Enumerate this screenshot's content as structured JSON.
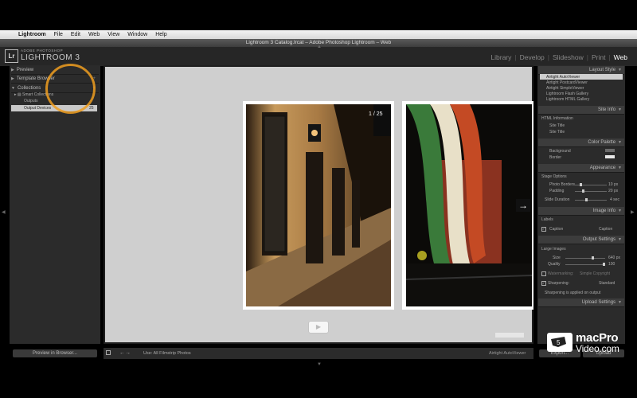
{
  "menubar": {
    "app": "Lightroom",
    "items": [
      "File",
      "Edit",
      "Web",
      "View",
      "Window",
      "Help"
    ]
  },
  "window_title": "Lightroom 3 Catalog.lrcat – Adobe Photoshop Lightroom – Web",
  "header": {
    "logo": "Lr",
    "brand_small": "ADOBE PHOTOSHOP",
    "brand": "LIGHTROOM 3",
    "modules": [
      "Library",
      "Develop",
      "Slideshow",
      "Print",
      "Web"
    ],
    "active_module": "Web"
  },
  "left_panel": {
    "sections": {
      "preview": "Preview",
      "template_browser": "Template Browser",
      "collections": "Collections"
    },
    "collection_items": [
      "Smart Collections",
      "Outputs",
      "Output Devices"
    ],
    "selected_count": "25",
    "preview_button": "Preview in Browser..."
  },
  "canvas": {
    "counter": "1 / 25",
    "next_glyph": "→",
    "play_glyph": "▶"
  },
  "toolbar": {
    "use_label": "Use: All Filmstrip Photos",
    "style_label": "Airtight AutoViewer",
    "prev": "←",
    "next": "→"
  },
  "right_panel": {
    "layout_style": {
      "title": "Layout Style",
      "options": [
        "Airtight AutoViewer",
        "Airtight PostcardViewer",
        "Airtight SimpleViewer",
        "Lightroom Flash Gallery",
        "Lightroom HTML Gallery"
      ],
      "selected": 0
    },
    "site_info": {
      "title": "Site Info",
      "subtitle": "HTML Information",
      "fields": [
        "Site Title",
        "Site Title"
      ]
    },
    "color_palette": {
      "title": "Color Palette",
      "rows": [
        {
          "label": "Background",
          "color": "#6a6a6a"
        },
        {
          "label": "Border",
          "color": "#e8e8e8"
        }
      ]
    },
    "appearance": {
      "title": "Appearance",
      "subtitle": "Stage Options",
      "rows": [
        {
          "label": "Photo Borders",
          "value": "10 px",
          "fraction": 0.15
        },
        {
          "label": "Padding",
          "value": "20 px",
          "fraction": 0.25
        },
        {
          "label": "Slide Duration",
          "value": "4 sec",
          "fraction": 0.35
        }
      ]
    },
    "image_info": {
      "title": "Image Info",
      "subtitle": "Labels",
      "caption_label": "Caption",
      "caption_value": "Caption"
    },
    "output_settings": {
      "title": "Output Settings",
      "subtitle": "Large Images",
      "rows": [
        {
          "label": "Size",
          "value": "640 px",
          "fraction": 0.7
        },
        {
          "label": "Quality",
          "value": "100",
          "fraction": 1.0
        }
      ],
      "watermark_label": "Watermarking:",
      "watermark_value": "Simple Copyright",
      "sharpening_label": "Sharpening:",
      "sharpening_value": "Standard",
      "note": "Sharpening is applied on output"
    },
    "upload_settings": {
      "title": "Upload Settings"
    },
    "export_button": "Export...",
    "upload_button": "Upload"
  },
  "watermark": {
    "line1": "macPro",
    "line2": "Video.com"
  }
}
